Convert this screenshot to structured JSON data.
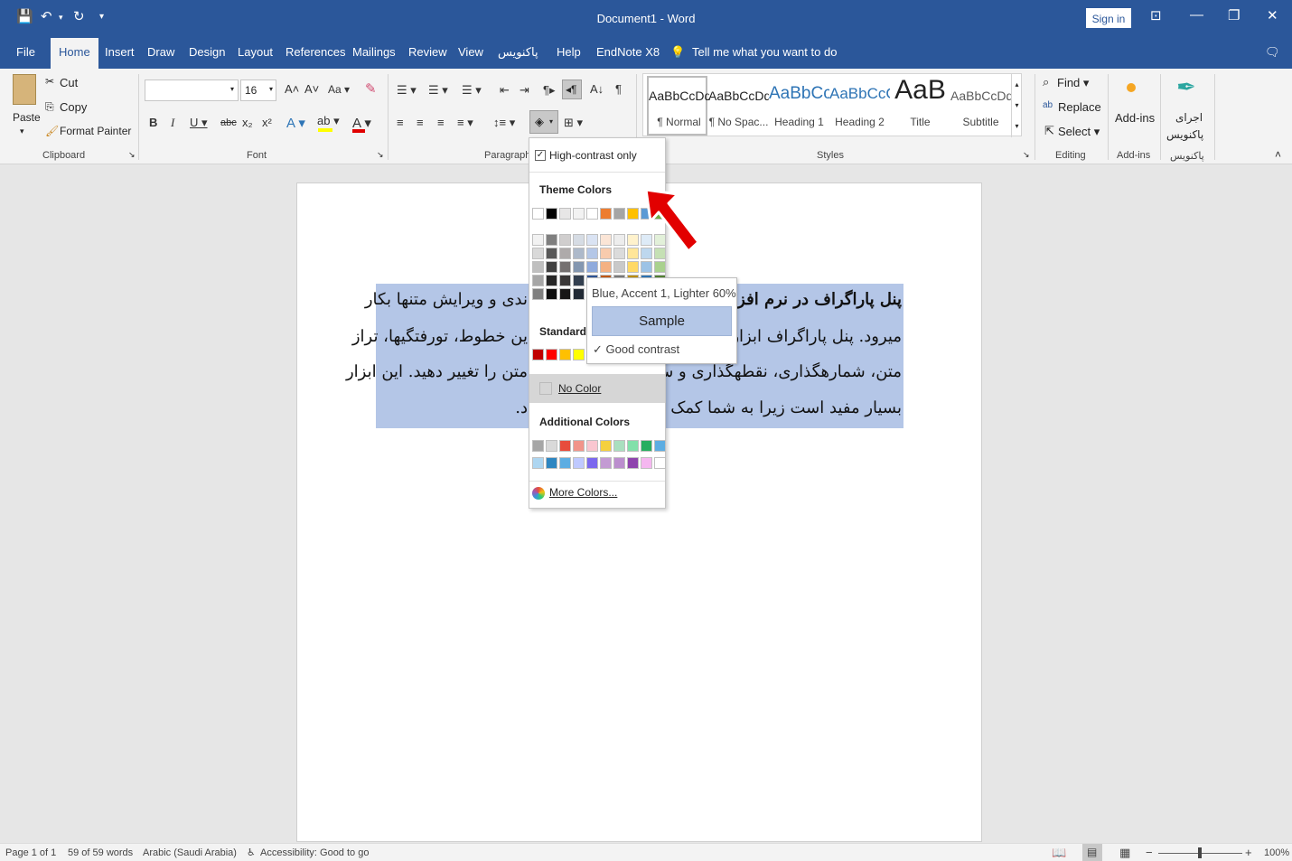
{
  "titlebar": {
    "title": "Document1  -  Word",
    "sign_in": "Sign in"
  },
  "tabs": [
    "File",
    "Home",
    "Insert",
    "Draw",
    "Design",
    "Layout",
    "References",
    "Mailings",
    "Review",
    "View",
    "پاکنویس",
    "Help",
    "EndNote X8"
  ],
  "tell_me": "Tell me what you want to do",
  "clipboard": {
    "paste": "Paste",
    "cut": "Cut",
    "copy": "Copy",
    "format_painter": "Format Painter",
    "label": "Clipboard"
  },
  "font": {
    "size": "16",
    "label": "Font",
    "case": "Aa"
  },
  "paragraph": {
    "label": "Paragraph"
  },
  "styles": {
    "label": "Styles",
    "items": [
      {
        "preview": "AaBbCcDd",
        "name": "¶ Normal"
      },
      {
        "preview": "AaBbCcDd",
        "name": "¶ No Spac..."
      },
      {
        "preview": "AaBbCc",
        "name": "Heading 1"
      },
      {
        "preview": "AaBbCcC",
        "name": "Heading 2"
      },
      {
        "preview": "AaB",
        "name": "Title"
      },
      {
        "preview": "AaBbCcDd",
        "name": "Subtitle"
      }
    ]
  },
  "editing": {
    "find": "Find",
    "replace": "Replace",
    "select": "Select",
    "label": "Editing"
  },
  "addins": {
    "addins": "Add-ins",
    "label": "Add-ins",
    "run_line1": "اجرای",
    "run_line2": "پاکنویس",
    "group2_label": "پاکنویس"
  },
  "document": {
    "lines": [
      "پنل پاراگراف در نرم افزار",
      "میرود. پنل پاراگراف ابزاری اس",
      "متن، شمارهگذاری، نقطهگذاری و سایر تنظیا",
      "بسیار مفید است زیرا به شما کمک کرده تا"
    ],
    "lines_left": [
      "ندی و ویرایش متنها بکار",
      "ین خطوط، تورفتگیها، تراز",
      "متن را تغییر دهید. این ابزار",
      "د."
    ]
  },
  "dropdown": {
    "high_contrast": "High-contrast only",
    "theme_colors": "Theme Colors",
    "standard": "Standard Colors",
    "no_color": "No Color",
    "additional": "Additional Colors",
    "more_colors": "More Colors...",
    "theme_row": [
      "#ffffff",
      "#000000",
      "#e7e6e6",
      "#f2f2f2",
      "#ffffff",
      "#ed7d31",
      "#a5a5a5",
      "#ffc000",
      "#5b9bd5",
      "#70ad47"
    ],
    "theme_cols": [
      [
        "#f2f2f2",
        "#d9d9d9",
        "#bfbfbf",
        "#a6a6a6",
        "#808080"
      ],
      [
        "#7f7f7f",
        "#595959",
        "#404040",
        "#262626",
        "#0d0d0d"
      ],
      [
        "#d0cece",
        "#aeaaaa",
        "#757171",
        "#3a3838",
        "#171616"
      ],
      [
        "#d6dce4",
        "#adb9ca",
        "#8497b0",
        "#333f4f",
        "#222a35"
      ],
      [
        "#dae3f3",
        "#b4c7e7",
        "#8faadc",
        "#2f5597",
        "#1f3864"
      ],
      [
        "#fbe5d6",
        "#f8cbad",
        "#f4b183",
        "#c55a11",
        "#843c0c"
      ],
      [
        "#ededed",
        "#dbdbdb",
        "#c9c9c9",
        "#7b7b7b",
        "#525252"
      ],
      [
        "#fff2cc",
        "#ffe699",
        "#ffd966",
        "#bf9000",
        "#7f6000"
      ],
      [
        "#deebf7",
        "#bdd7ee",
        "#9dc3e6",
        "#2e75b6",
        "#1f4e79"
      ],
      [
        "#e2f0d9",
        "#c5e0b4",
        "#a9d18e",
        "#538135",
        "#375623"
      ]
    ],
    "standard_row": [
      "#c00000",
      "#ff0000",
      "#ffc000",
      "#ffff00",
      "#92d050",
      "#00b050",
      "#00b0f0",
      "#0070c0",
      "#002060",
      "#7030a0"
    ],
    "additional_row1": [
      "#a6a6a6",
      "#d9d9d9",
      "#e74c3c",
      "#f1948a",
      "#f9c6d0",
      "#f4d03f",
      "#a9dfbf",
      "#82e0aa",
      "#27ae60",
      "#5dade2"
    ],
    "additional_row2": [
      "#aed6f1",
      "#2e86c1",
      "#5dade2",
      "#bfc9ff",
      "#7b68ee",
      "#c39bd3",
      "#bb8fce",
      "#8e44ad",
      "#f5b7f0",
      "#ffffff"
    ]
  },
  "tooltip": {
    "color_name": "Blue, Accent 1, Lighter 60%",
    "sample": "Sample",
    "contrast": "Good contrast",
    "accent": "#b4c7e7"
  },
  "status": {
    "page": "Page 1 of 1",
    "words": "59 of 59 words",
    "lang": "Arabic (Saudi Arabia)",
    "accessibility": "Accessibility: Good to go",
    "zoom": "100%"
  },
  "colors": {
    "brand": "#2b579a",
    "highlight": "#b4c6e7"
  }
}
